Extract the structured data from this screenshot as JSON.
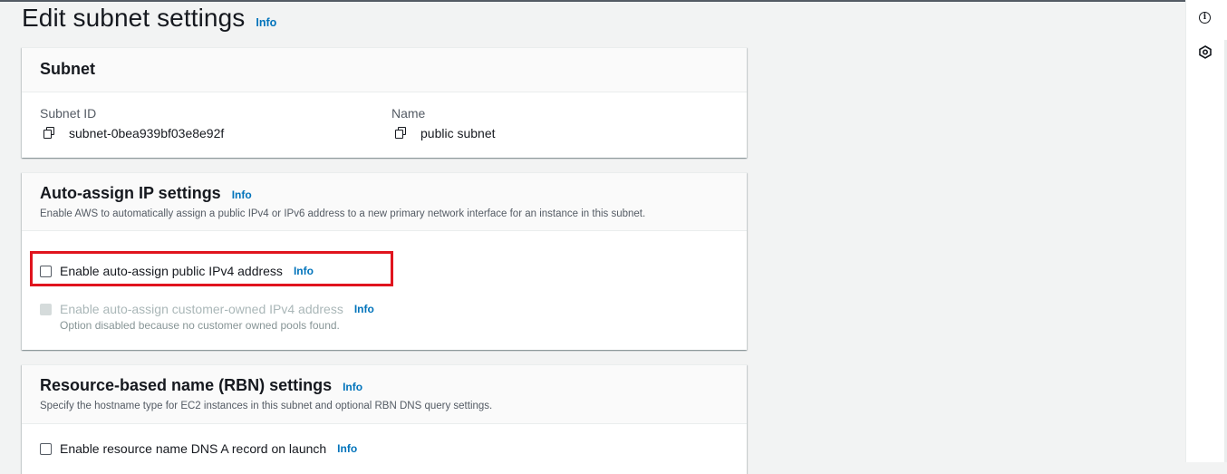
{
  "page": {
    "title": "Edit subnet settings",
    "info_label": "Info"
  },
  "subnet_panel": {
    "title": "Subnet",
    "subnet_id_label": "Subnet ID",
    "subnet_id_value": "subnet-0bea939bf03e8e92f",
    "name_label": "Name",
    "name_value": "public subnet"
  },
  "auto_assign_panel": {
    "title": "Auto-assign IP settings",
    "info_label": "Info",
    "description": "Enable AWS to automatically assign a public IPv4 or IPv6 address to a new primary network interface for an instance in this subnet.",
    "option_public_ipv4": {
      "label": "Enable auto-assign public IPv4 address",
      "info_label": "Info",
      "checked": false,
      "highlighted": true
    },
    "option_customer_owned": {
      "label": "Enable auto-assign customer-owned IPv4 address",
      "info_label": "Info",
      "note": "Option disabled because no customer owned pools found.",
      "checked": false,
      "disabled": true
    }
  },
  "rbn_panel": {
    "title": "Resource-based name (RBN) settings",
    "info_label": "Info",
    "description": "Specify the hostname type for EC2 instances in this subnet and optional RBN DNS query settings.",
    "option_dns_a_record": {
      "label": "Enable resource name DNS A record on launch",
      "info_label": "Info",
      "checked": false
    }
  },
  "right_rail": {
    "icons": [
      "info-circle-icon",
      "hexagon-settings-icon"
    ]
  },
  "colors": {
    "link": "#0073bb",
    "highlight": "#e0141e",
    "background": "#f2f3f3"
  }
}
